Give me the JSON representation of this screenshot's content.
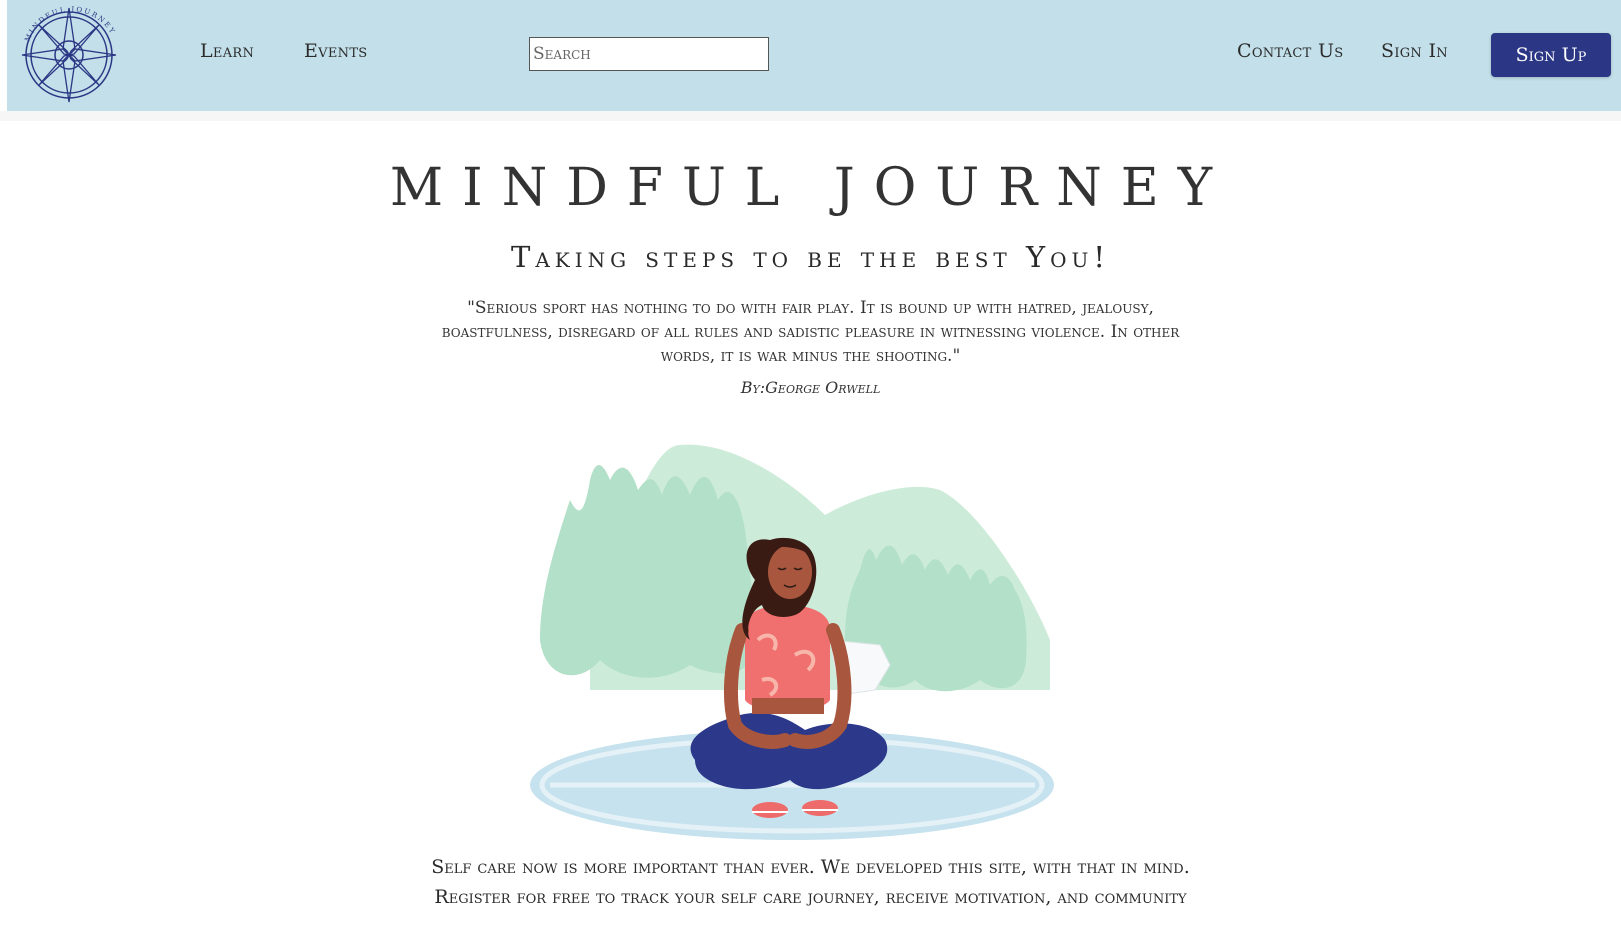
{
  "header": {
    "logo_text": "MINDFUL JOURNEY",
    "nav_links": [
      "Learn",
      "Events"
    ],
    "search": {
      "placeholder": "Search",
      "value": ""
    },
    "right_links": [
      "Contact Us",
      "Sign In"
    ],
    "signup_label": "Sign Up"
  },
  "hero": {
    "title": "MINDFUL JOURNEY",
    "tagline": "Taking steps to be the best You!",
    "quote": "\"Serious sport has nothing to do with fair play. It is bound up with hatred, jealousy, boastfulness, disregard of all rules and sadistic pleasure in witnessing violence. In other words, it is war minus the shooting.\"",
    "quote_author": "By:George Orwell",
    "description": "Self care now is more important than ever. We developed this site, with that in mind. Register for free to track your self care journey, receive motivation, and community"
  },
  "colors": {
    "navbar_bg": "#c3e0ea",
    "brand_navy": "#2b3784",
    "tree_green": "#b3e0c8",
    "mountain_green": "#cdebd9",
    "mat_blue": "#c6e2ee"
  },
  "icons": {
    "logo": "compass-rose-icon",
    "hero": "meditating-woman-illustration"
  }
}
